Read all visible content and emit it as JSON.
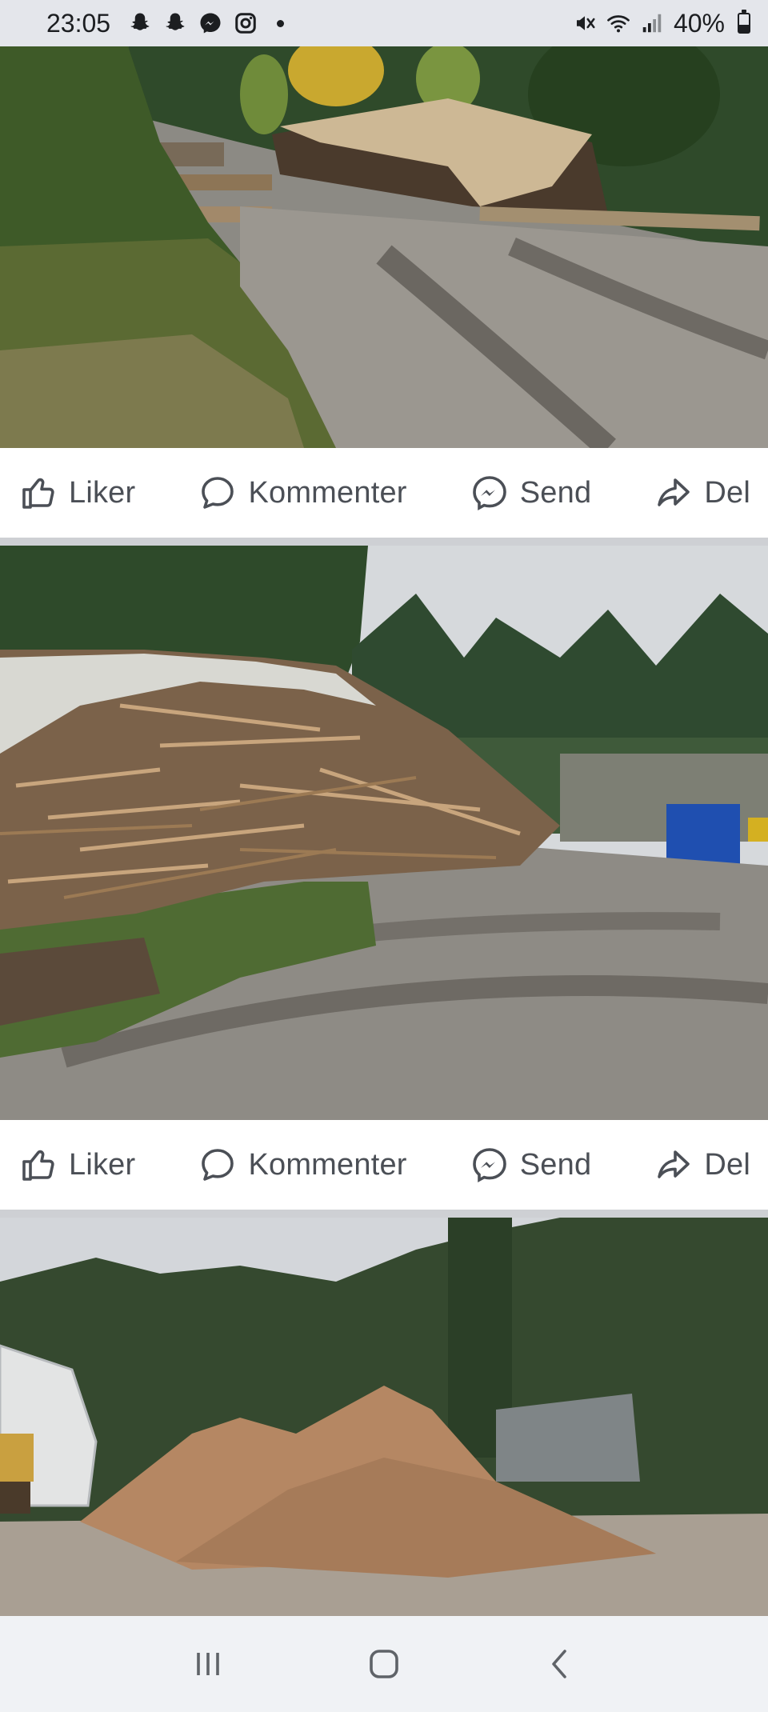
{
  "status_bar": {
    "time": "23:05",
    "battery": "40%",
    "icons": [
      "snapchat-icon",
      "snapchat-icon",
      "messenger-icon",
      "instagram-icon",
      "notification-dot",
      "mute-icon",
      "wifi-icon",
      "signal-icon",
      "battery-icon"
    ]
  },
  "posts": [
    {
      "photo": "Log piles under tarp beside a gravel forest road",
      "actions": {
        "like": "Liker",
        "comment": "Kommenter",
        "send": "Send",
        "share": "Del"
      }
    },
    {
      "photo": "Large pile of wood offcuts beside a muddy yard with blue container",
      "actions": {
        "like": "Liker",
        "comment": "Kommenter",
        "send": "Send",
        "share": "Del"
      }
    },
    {
      "photo": "Piles of wood chips in front of forest",
      "actions": {}
    }
  ],
  "nav_bar": {
    "items": [
      "recent-apps-icon",
      "home-icon",
      "back-icon"
    ]
  },
  "colors": {
    "status_bg": "#e4e6eb",
    "action_text": "#4b4f56",
    "divider": "#ced0d4"
  }
}
